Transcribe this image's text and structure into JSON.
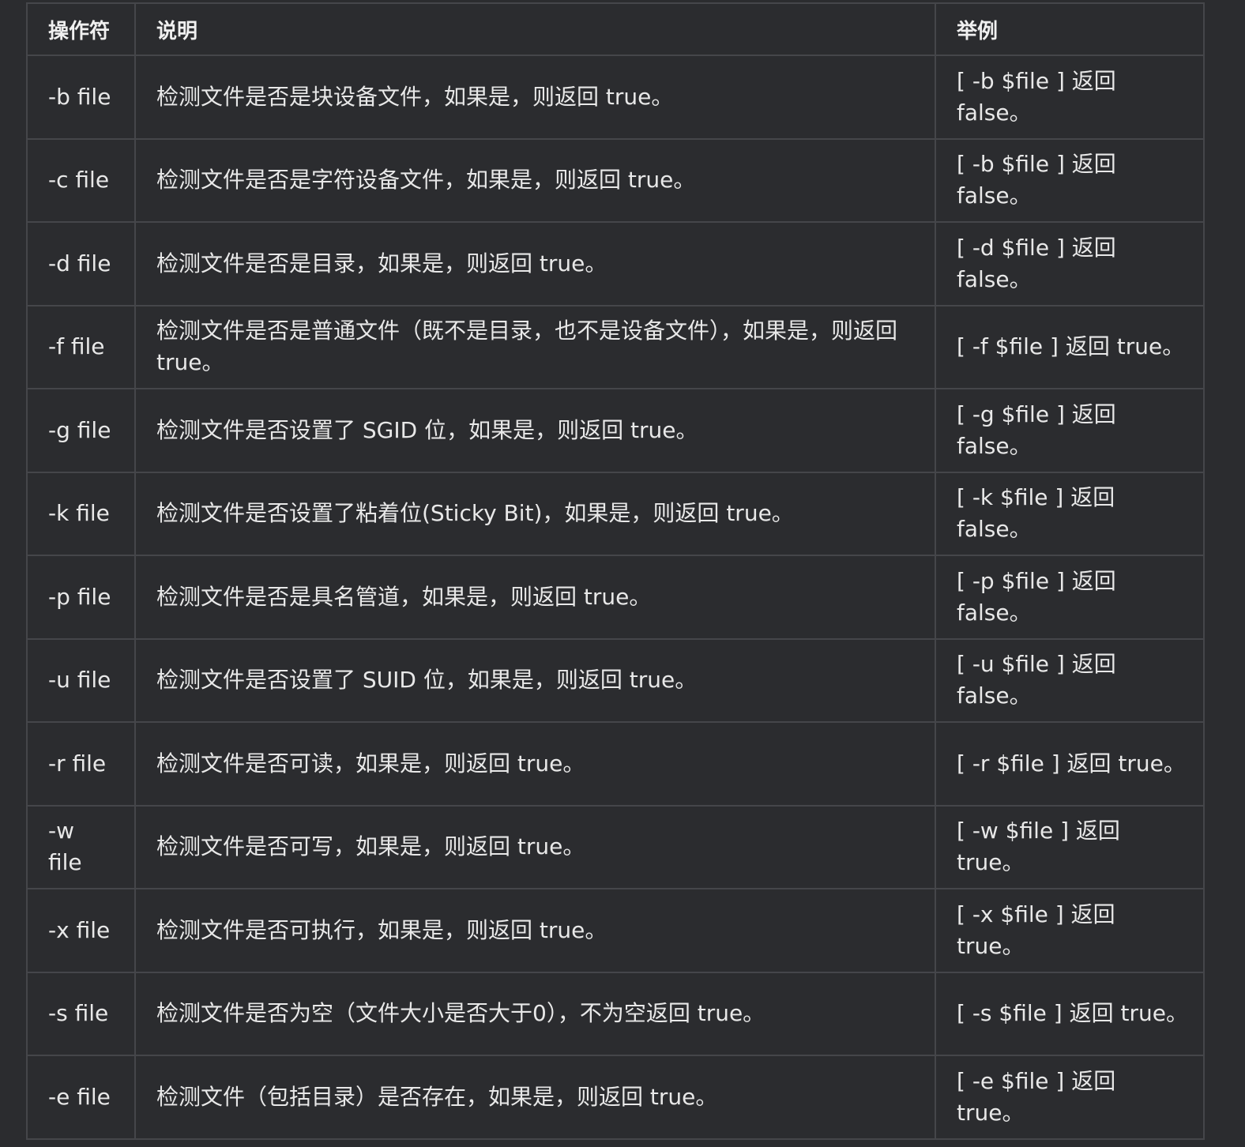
{
  "table": {
    "headers": [
      "操作符",
      "说明",
      "举例"
    ],
    "rows": [
      {
        "op": "-b file",
        "desc": "检测文件是否是块设备文件，如果是，则返回 true。",
        "example": "[ -b $file ] 返回 false。"
      },
      {
        "op": "-c file",
        "desc": "检测文件是否是字符设备文件，如果是，则返回 true。",
        "example": "[ -b $file ] 返回 false。"
      },
      {
        "op": "-d file",
        "desc": "检测文件是否是目录，如果是，则返回 true。",
        "example": "[ -d $file ] 返回 false。"
      },
      {
        "op": "-f file",
        "desc": "检测文件是否是普通文件（既不是目录，也不是设备文件），如果是，则返回 true。",
        "example": "[ -f $file ] 返回 true。"
      },
      {
        "op": "-g file",
        "desc": "检测文件是否设置了 SGID 位，如果是，则返回 true。",
        "example": "[ -g $file ] 返回 false。"
      },
      {
        "op": "-k file",
        "desc": "检测文件是否设置了粘着位(Sticky Bit)，如果是，则返回 true。",
        "example": "[ -k $file ] 返回 false。"
      },
      {
        "op": "-p file",
        "desc": "检测文件是否是具名管道，如果是，则返回 true。",
        "example": "[ -p $file ] 返回 false。"
      },
      {
        "op": "-u file",
        "desc": "检测文件是否设置了 SUID 位，如果是，则返回 true。",
        "example": "[ -u $file ] 返回 false。"
      },
      {
        "op": "-r file",
        "desc": "检测文件是否可读，如果是，则返回 true。",
        "example": "[ -r $file ] 返回 true。"
      },
      {
        "op": "-w file",
        "desc": "检测文件是否可写，如果是，则返回 true。",
        "example": "[ -w $file ] 返回 true。"
      },
      {
        "op": "-x file",
        "desc": "检测文件是否可执行，如果是，则返回 true。",
        "example": "[ -x $file ] 返回 true。"
      },
      {
        "op": "-s file",
        "desc": "检测文件是否为空（文件大小是否大于0），不为空返回 true。",
        "example": "[ -s $file ] 返回 true。"
      },
      {
        "op": "-e file",
        "desc": "检测文件（包括目录）是否存在，如果是，则返回 true。",
        "example": "[ -e $file ] 返回 true。"
      }
    ]
  }
}
